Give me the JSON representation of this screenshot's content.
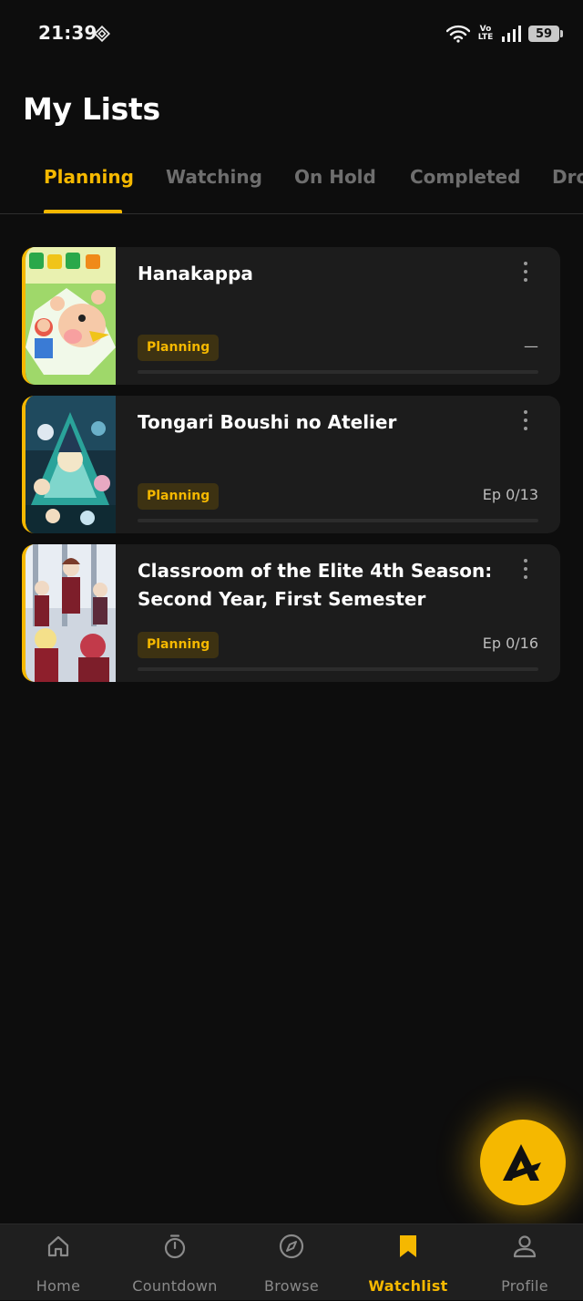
{
  "status_bar": {
    "time": "21:39",
    "network": "Vo\nLTE",
    "battery": "59"
  },
  "header": {
    "title": "My Lists"
  },
  "tabs": [
    {
      "label": "Planning",
      "active": true
    },
    {
      "label": "Watching",
      "active": false
    },
    {
      "label": "On Hold",
      "active": false
    },
    {
      "label": "Completed",
      "active": false
    },
    {
      "label": "Dro",
      "active": false
    }
  ],
  "entries": [
    {
      "title": "Hanakappa",
      "status": "Planning",
      "episodes": "—",
      "progress": 0
    },
    {
      "title": "Tongari Boushi no Atelier",
      "status": "Planning",
      "episodes": "Ep 0/13",
      "progress": 0
    },
    {
      "title": "Classroom of the Elite 4th Season: Second Year, First Semester",
      "status": "Planning",
      "episodes": "Ep 0/16",
      "progress": 0
    }
  ],
  "fab": {
    "icon": "app-logo-icon"
  },
  "bottom_nav": [
    {
      "label": "Home",
      "icon": "home-icon",
      "active": false
    },
    {
      "label": "Countdown",
      "icon": "timer-icon",
      "active": false
    },
    {
      "label": "Browse",
      "icon": "compass-icon",
      "active": false
    },
    {
      "label": "Watchlist",
      "icon": "bookmark-icon",
      "active": true
    },
    {
      "label": "Profile",
      "icon": "person-icon",
      "active": false
    }
  ],
  "colors": {
    "accent": "#f5b800",
    "background": "#0d0d0d",
    "card": "#1c1c1c",
    "inactive": "#6e6e6e"
  }
}
